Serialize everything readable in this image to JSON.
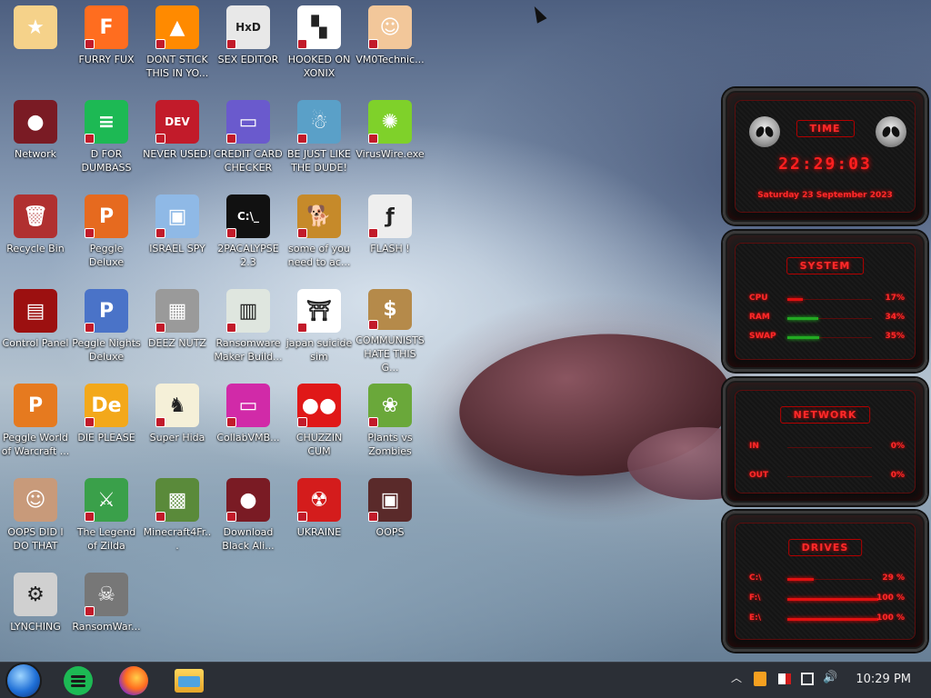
{
  "desktop": {
    "icons": [
      {
        "label": "",
        "bg": "#f5d28a",
        "glyph": "★"
      },
      {
        "label": "FURRY FUX",
        "bg": "#ff6d1f",
        "glyph": "F"
      },
      {
        "label": "DONT STICK THIS IN YO...",
        "bg": "#ff8a00",
        "glyph": "▲"
      },
      {
        "label": "SEX EDITOR",
        "bg": "#e8e8e8",
        "glyph": "HxD"
      },
      {
        "label": "HOOKED ON XONIX",
        "bg": "#ffffff",
        "glyph": "▚"
      },
      {
        "label": "VM0Technic...",
        "bg": "#f2c79a",
        "glyph": "☺"
      },
      {
        "label": "Network",
        "bg": "#7a1b24",
        "glyph": "●"
      },
      {
        "label": "D FOR DUMBASS",
        "bg": "#1db954",
        "glyph": "≡"
      },
      {
        "label": "NEVER USED!",
        "bg": "#c21b2a",
        "glyph": "DEV"
      },
      {
        "label": "CREDIT CARD CHECKER",
        "bg": "#6a5acd",
        "glyph": "▭"
      },
      {
        "label": "BE JUST LIKE THE DUDE!",
        "bg": "#5aa0c8",
        "glyph": "☃"
      },
      {
        "label": "VirusWire.exe",
        "bg": "#7fd12a",
        "glyph": "✺"
      },
      {
        "label": "Recycle Bin",
        "bg": "#b03030",
        "glyph": "🗑"
      },
      {
        "label": "Peggle Deluxe",
        "bg": "#e66a1f",
        "glyph": "P"
      },
      {
        "label": "ISRAEL SPY",
        "bg": "#8fb9e6",
        "glyph": "▣"
      },
      {
        "label": "2PACALYPSE 2.3",
        "bg": "#111111",
        "glyph": "C:\\_"
      },
      {
        "label": "some of you need to ac...",
        "bg": "#c68a2a",
        "glyph": "🐕"
      },
      {
        "label": "FLASH !",
        "bg": "#eeeeee",
        "glyph": "ƒ"
      },
      {
        "label": "Control Panel",
        "bg": "#9c1010",
        "glyph": "▤"
      },
      {
        "label": "Peggle Nights Deluxe",
        "bg": "#4a73c8",
        "glyph": "P"
      },
      {
        "label": "DEEZ NUTZ",
        "bg": "#9a9a9a",
        "glyph": "▦"
      },
      {
        "label": "Ransomware Maker Build...",
        "bg": "#dfe6df",
        "glyph": "▥"
      },
      {
        "label": "japan suicide sim",
        "bg": "#ffffff",
        "glyph": "⛩"
      },
      {
        "label": "COMMUNISTS HATE THIS G...",
        "bg": "#b58a4a",
        "glyph": "$"
      },
      {
        "label": "Peggle World of Warcraft ...",
        "bg": "#e67a1f",
        "glyph": "P"
      },
      {
        "label": "DIE PLEASE",
        "bg": "#f3a81a",
        "glyph": "De"
      },
      {
        "label": "Super Hida",
        "bg": "#f5f0d8",
        "glyph": "♞"
      },
      {
        "label": "CollabVMB...",
        "bg": "#d12aa8",
        "glyph": "▭"
      },
      {
        "label": "CHUZZIN CUM",
        "bg": "#e01818",
        "glyph": "●●"
      },
      {
        "label": "Plants vs Zombies",
        "bg": "#6aa83a",
        "glyph": "❀"
      },
      {
        "label": "OOPS DID I DO THAT",
        "bg": "#c89a7a",
        "glyph": "☺"
      },
      {
        "label": "The Legend of Zilda",
        "bg": "#3aa04a",
        "glyph": "⚔"
      },
      {
        "label": "Minecraft4Fr...",
        "bg": "#5a8a3a",
        "glyph": "▩"
      },
      {
        "label": "Download Black Ali...",
        "bg": "#7a1b24",
        "glyph": "●"
      },
      {
        "label": "UKRAINE",
        "bg": "#d41c1c",
        "glyph": "☢"
      },
      {
        "label": "OOPS",
        "bg": "#5a2a2a",
        "glyph": "▣"
      },
      {
        "label": "LYNCHING",
        "bg": "#d0d0d0",
        "glyph": "⚙"
      },
      {
        "label": "RansomWar...",
        "bg": "#777777",
        "glyph": "☠"
      }
    ]
  },
  "widgets": {
    "time": {
      "title": "TIME",
      "clock": "22:29:03",
      "date": "Saturday 23 September 2023"
    },
    "system": {
      "title": "SYSTEM",
      "rows": [
        {
          "label": "CPU",
          "value": "17%",
          "level": 0.17,
          "color": "red"
        },
        {
          "label": "RAM",
          "value": "34%",
          "level": 0.34,
          "color": "green"
        },
        {
          "label": "SWAP",
          "value": "35%",
          "level": 0.35,
          "color": "green"
        }
      ]
    },
    "network": {
      "title": "NETWORK",
      "rows": [
        {
          "label": "IN",
          "value": "0%",
          "level": 0.0
        },
        {
          "label": "OUT",
          "value": "0%",
          "level": 0.0
        }
      ]
    },
    "drives": {
      "title": "DRIVES",
      "rows": [
        {
          "label": "C:\\",
          "value": "29 %",
          "level": 0.29
        },
        {
          "label": "F:\\",
          "value": "100 %",
          "level": 1.0
        },
        {
          "label": "E:\\",
          "value": "100 %",
          "level": 1.0
        }
      ]
    }
  },
  "taskbar": {
    "clock": "10:29 PM",
    "pinned": [
      "start-orb",
      "spotify-icon",
      "firefox-icon",
      "file-explorer-icon"
    ],
    "tray": [
      "chevron-up-icon",
      "notification-app-icon",
      "flag-icon",
      "network-icon",
      "volume-icon"
    ]
  }
}
